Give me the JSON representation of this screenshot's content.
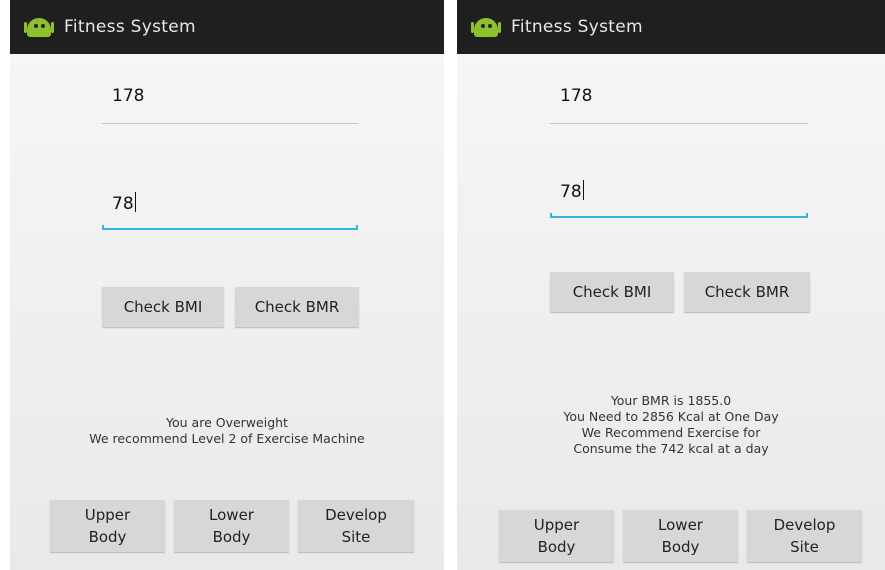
{
  "app": {
    "title": "Fitness System"
  },
  "left": {
    "height_value": "178",
    "weight_value": "78",
    "check_bmi_label": "Check BMI",
    "check_bmr_label": "Check BMR",
    "result_lines": [
      "You are Overweight",
      "We recommend Level 2 of Exercise Machine"
    ],
    "nav": [
      {
        "line1": "Upper",
        "line2": "Body"
      },
      {
        "line1": "Lower",
        "line2": "Body"
      },
      {
        "line1": "Develop",
        "line2": "Site"
      }
    ]
  },
  "right": {
    "height_value": "178",
    "weight_value": "78",
    "check_bmi_label": "Check BMI",
    "check_bmr_label": "Check BMR",
    "result_lines": [
      "Your BMR is 1855.0",
      "You Need to 2856 Kcal at One Day",
      "We Recommend Exercise for",
      "Consume the 742 kcal at a day"
    ],
    "nav": [
      {
        "line1": "Upper",
        "line2": "Body"
      },
      {
        "line1": "Lower",
        "line2": "Body"
      },
      {
        "line1": "Develop",
        "line2": "Site"
      }
    ]
  },
  "colors": {
    "actionbar": "#1f1f1f",
    "focus_line": "#33b5e5",
    "button": "#d7d7d7",
    "android_green": "#8fbf2c"
  }
}
